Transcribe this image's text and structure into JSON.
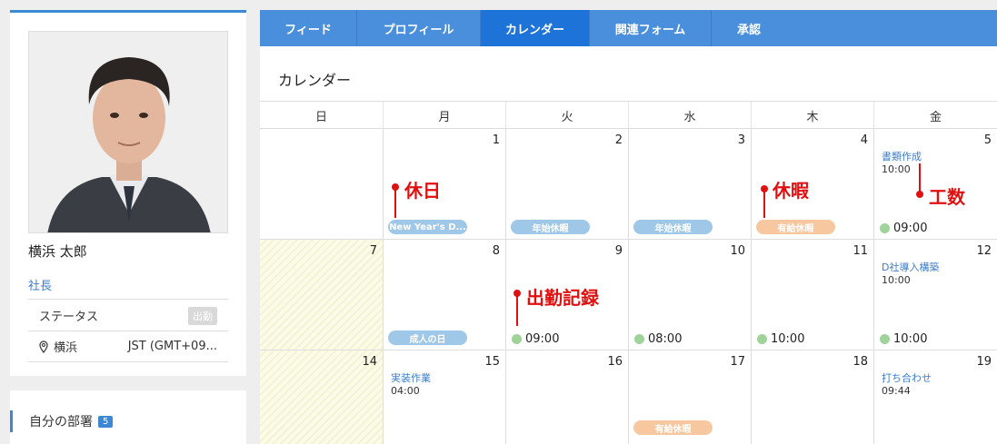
{
  "profile": {
    "name": "横浜 太郎",
    "title": "社長",
    "status_label": "ステータス",
    "status_badge": "出勤",
    "location": "横浜",
    "timezone": "JST (GMT+09..."
  },
  "department": {
    "label": "自分の部署",
    "count": "5"
  },
  "tabs": [
    {
      "label": "フィード"
    },
    {
      "label": "プロフィール"
    },
    {
      "label": "カレンダー",
      "active": true
    },
    {
      "label": "関連フォーム"
    },
    {
      "label": "承認"
    }
  ],
  "section_title": "カレンダー",
  "weekdays": [
    "日",
    "月",
    "火",
    "水",
    "木",
    "金"
  ],
  "days": {
    "d1": "1",
    "d2": "2",
    "d3": "3",
    "d4": "4",
    "d5": "5",
    "d7": "7",
    "d8": "8",
    "d9": "9",
    "d10": "10",
    "d11": "11",
    "d12": "12",
    "d14": "14",
    "d15": "15",
    "d16": "16",
    "d17": "17",
    "d18": "18",
    "d19": "19"
  },
  "events": {
    "new_years": "New Year's D...",
    "nenshi1": "年始休暇",
    "nenshi2": "年始休暇",
    "yukyu1": "有給休暇",
    "shorui_title": "書類作成",
    "shorui_time": "10:00",
    "att5": "09:00",
    "seijin": "成人の日",
    "att9": "09:00",
    "att10": "08:00",
    "att11": "10:00",
    "dsha_title": "D社導入構築",
    "dsha_time": "10:00",
    "att12": "10:00",
    "jisso_title": "実装作業",
    "jisso_time": "04:00",
    "yukyu2": "有給休暇",
    "uchiawase_title": "打ち合わせ",
    "uchiawase_time": "09:44"
  },
  "annotations": {
    "holiday": "休日",
    "vacation": "休暇",
    "kosuu": "工数",
    "attendance": "出勤記録"
  },
  "colors": {
    "tab_bar": "#4a8fdc",
    "tab_active": "#1d73d8",
    "annotation": "#e01010",
    "holiday_pill": "#9fc8e8",
    "vacation_pill": "#f7c8a0",
    "attendance_dot": "#9fd39a"
  }
}
